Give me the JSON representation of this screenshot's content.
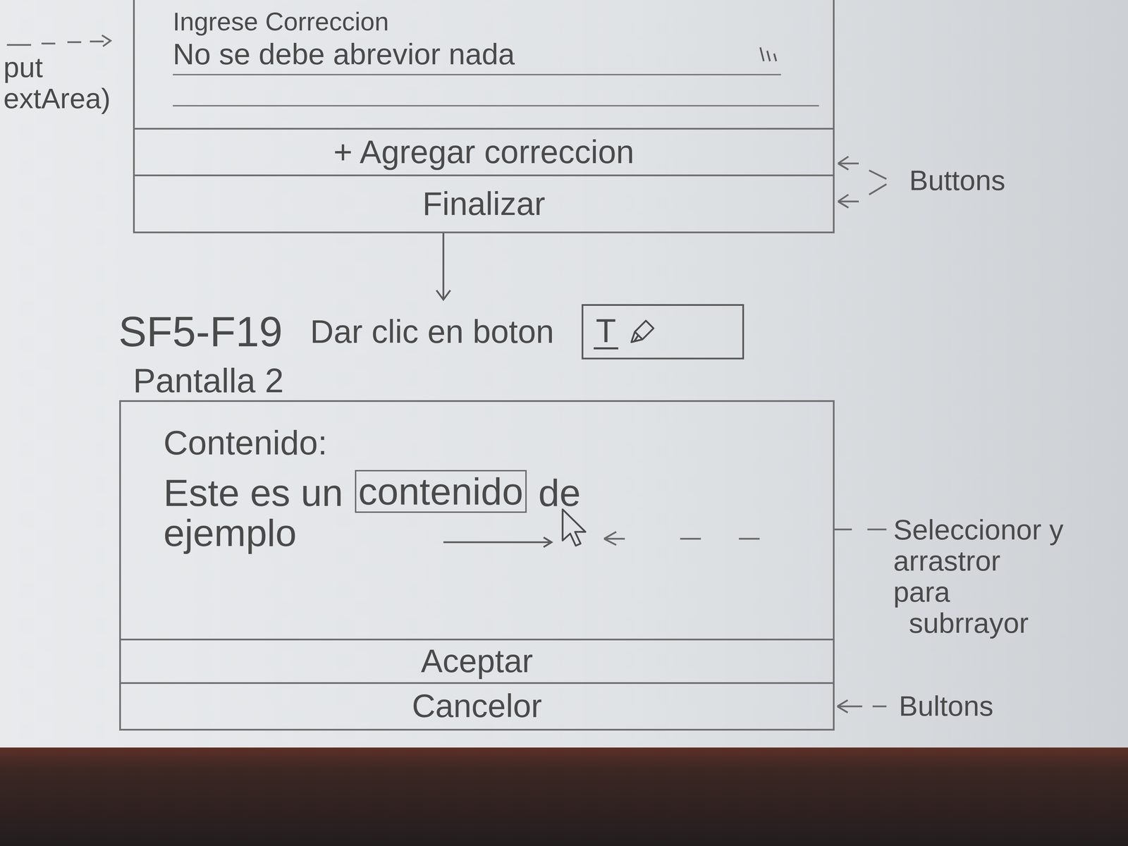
{
  "step1": {
    "note": [
      "put",
      "extArea)"
    ],
    "label": "Ingrese Correccion",
    "value": "No se debe abrevior nada",
    "buttons": [
      "+ Agregar correccion",
      "Finalizar"
    ],
    "buttons_note": "Buttons"
  },
  "step2": {
    "code": "SF5-F19",
    "instruction": "Dar clic en boton",
    "icon_button": {
      "label": "T"
    },
    "screen_title": "Pantalla 2",
    "content_label": "Contenido:",
    "content_lines": [
      [
        {
          "text": "Este es un",
          "selected": false
        },
        {
          "text": "contenido",
          "selected": true
        },
        {
          "text": "de",
          "selected": false
        }
      ],
      [
        {
          "text": "ejemplo",
          "selected": false
        }
      ]
    ],
    "selection_note": [
      "Seleccionor y",
      "arrastror",
      "para",
      "subrrayor"
    ],
    "buttons": [
      "Aceptar",
      "Cancelor"
    ],
    "buttons_note": "Bultons"
  }
}
